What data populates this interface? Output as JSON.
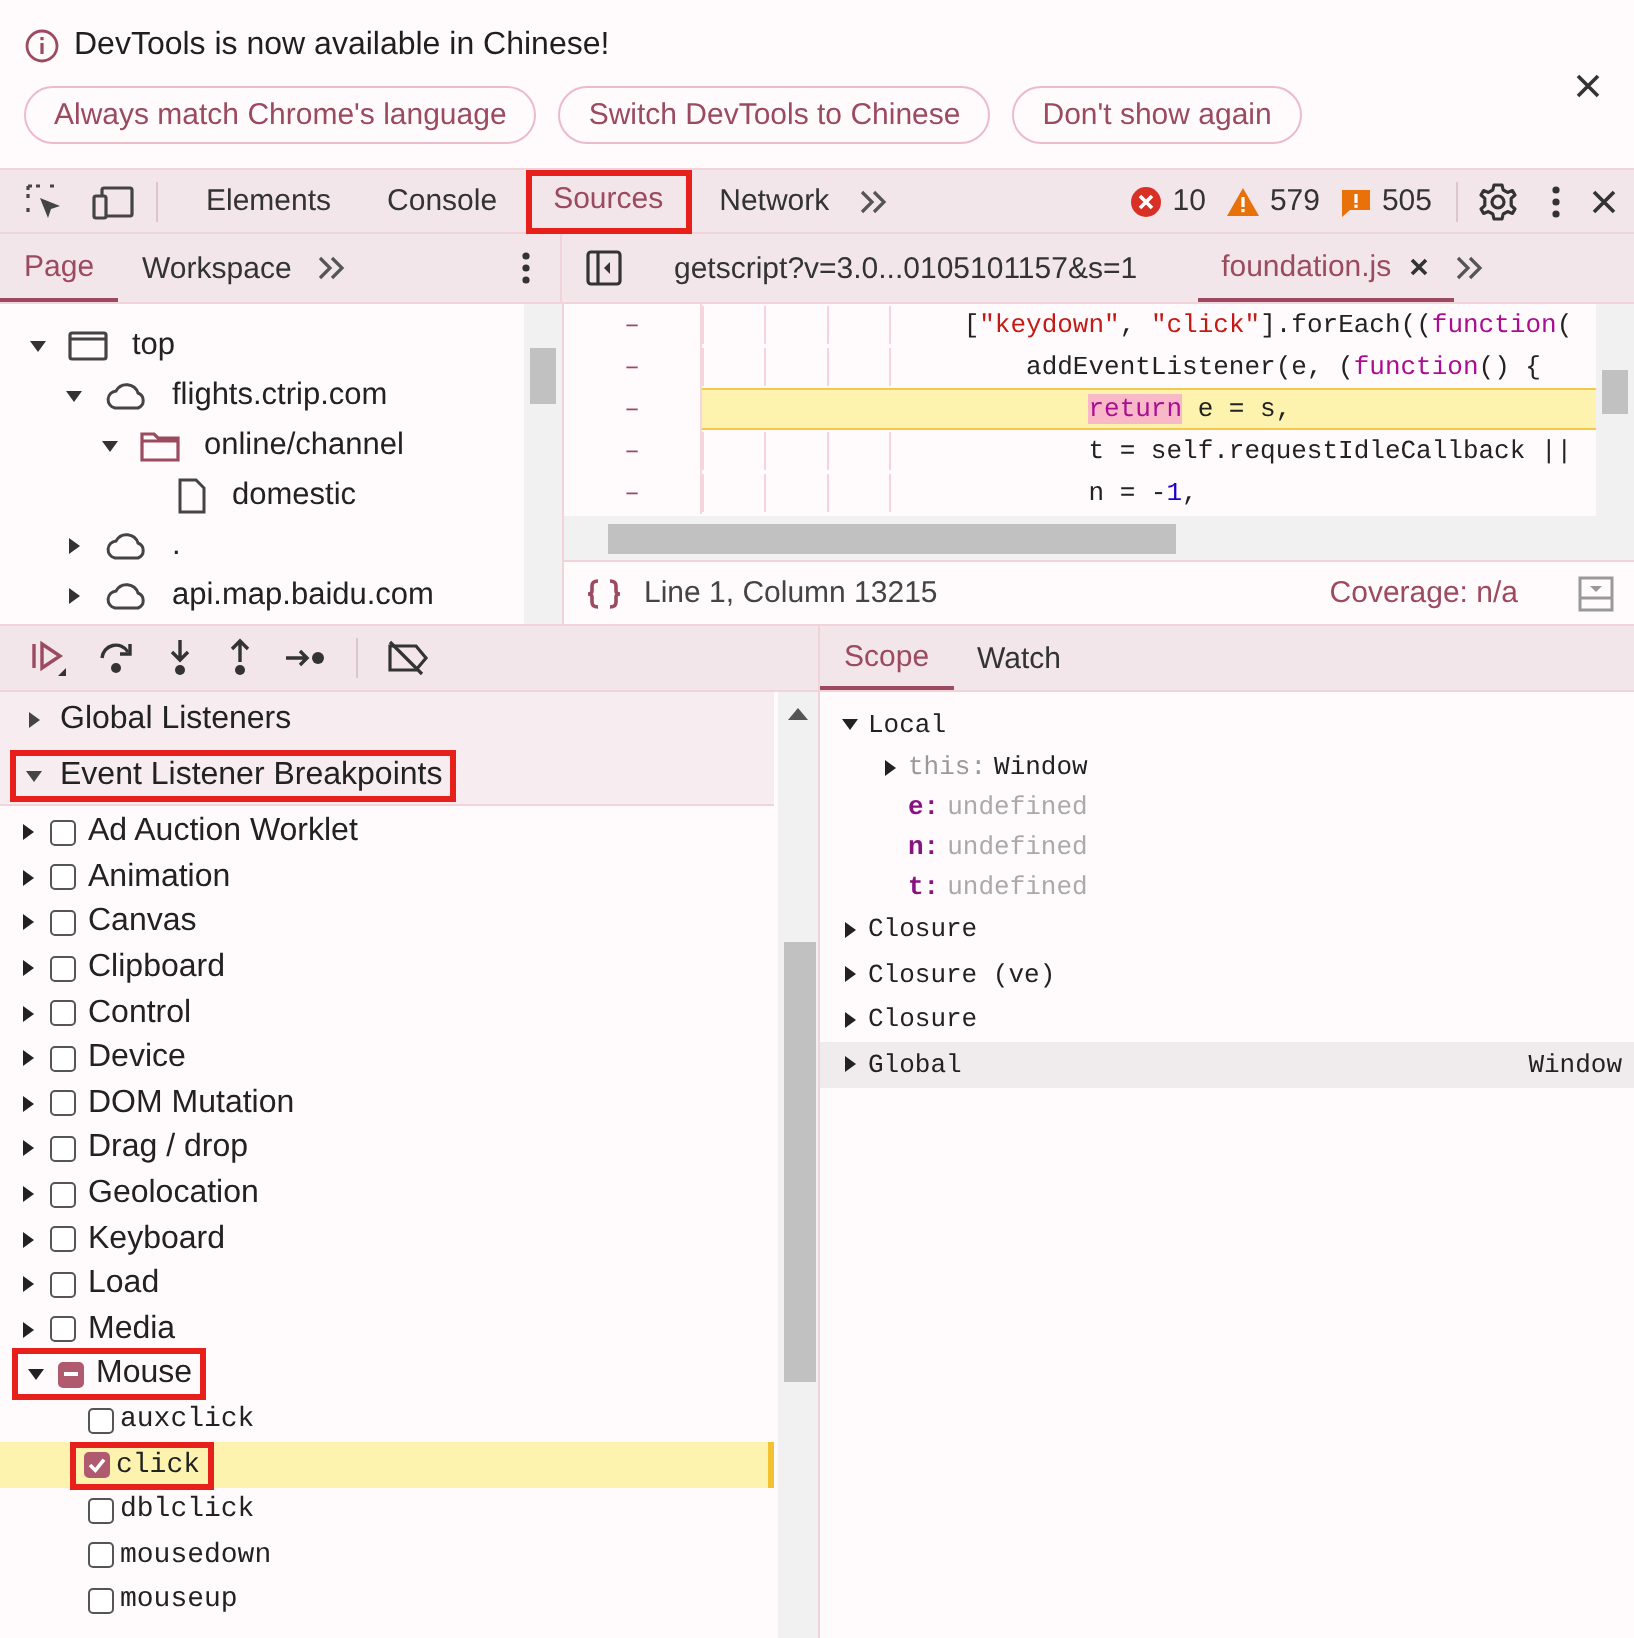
{
  "infobar": {
    "message": "DevTools is now available in Chinese!",
    "buttons": [
      "Always match Chrome's language",
      "Switch DevTools to Chinese",
      "Don't show again"
    ]
  },
  "main_tabs": [
    {
      "label": "Elements",
      "selected": false
    },
    {
      "label": "Console",
      "selected": false
    },
    {
      "label": "Sources",
      "selected": true,
      "annotated": true
    },
    {
      "label": "Network",
      "selected": false
    }
  ],
  "counters": [
    {
      "kind": "error",
      "count": "10"
    },
    {
      "kind": "warning",
      "count": "579"
    },
    {
      "kind": "issue",
      "count": "505"
    }
  ],
  "navigator": {
    "tabs": [
      {
        "label": "Page",
        "selected": true
      },
      {
        "label": "Workspace",
        "selected": false
      }
    ],
    "tree": [
      {
        "label": "top",
        "kind": "frame",
        "expanded": true,
        "children": [
          {
            "label": "flights.ctrip.com",
            "kind": "domain",
            "expanded": true,
            "children": [
              {
                "label": "online/channel",
                "kind": "folder",
                "expanded": true,
                "children": [
                  {
                    "label": "domestic",
                    "kind": "file"
                  }
                ]
              }
            ]
          },
          {
            "label": ".",
            "kind": "domain",
            "expanded": false
          },
          {
            "label": "api.map.baidu.com",
            "kind": "domain",
            "expanded": false
          }
        ]
      }
    ]
  },
  "editor": {
    "tabs": [
      {
        "label": "getscript?v=3.0...0105101157&s=1",
        "selected": false,
        "closable": false
      },
      {
        "label": "foundation.js",
        "selected": true,
        "closable": true
      }
    ],
    "lines": [
      {
        "marker": "–",
        "paused": false,
        "tokens": [
          {
            "kind": "plain",
            "text": "["
          },
          {
            "kind": "string",
            "text": "\"keydown\""
          },
          {
            "kind": "plain",
            "text": ", "
          },
          {
            "kind": "string",
            "text": "\"click\""
          },
          {
            "kind": "plain",
            "text": "].forEach(("
          },
          {
            "kind": "keyword",
            "text": "function"
          },
          {
            "kind": "plain",
            "text": "("
          }
        ],
        "children": [
          {
            "marker": "–",
            "paused": false,
            "tokens": [
              {
                "kind": "plain",
                "text": "addEventListener(e, ("
              },
              {
                "kind": "keyword",
                "text": "function"
              },
              {
                "kind": "plain",
                "text": "() {"
              }
            ],
            "children": [
              {
                "marker": "–",
                "paused": true,
                "tokens": [
                  {
                    "kind": "execution",
                    "text": "return"
                  },
                  {
                    "kind": "plain",
                    "text": " e = s,"
                  }
                ]
              },
              {
                "marker": "–",
                "paused": false,
                "tokens": [
                  {
                    "kind": "plain",
                    "text": "t = self.requestIdleCallback ||"
                  }
                ]
              },
              {
                "marker": "–",
                "paused": false,
                "tokens": [
                  {
                    "kind": "plain",
                    "text": "n = -"
                  },
                  {
                    "kind": "number",
                    "text": "1"
                  },
                  {
                    "kind": "plain",
                    "text": ","
                  }
                ]
              }
            ]
          }
        ]
      }
    ],
    "status": {
      "position": "Line 1, Column 13215",
      "coverage": "Coverage: n/a"
    }
  },
  "debugger": {
    "sections": [
      {
        "label": "Global Listeners",
        "expanded": false
      },
      {
        "label": "Event Listener Breakpoints",
        "expanded": true,
        "annotated": true,
        "categories": [
          {
            "label": "Ad Auction Worklet",
            "expanded": false,
            "checked": false,
            "indeterminate": false
          },
          {
            "label": "Animation",
            "expanded": false,
            "checked": false,
            "indeterminate": false
          },
          {
            "label": "Canvas",
            "expanded": false,
            "checked": false,
            "indeterminate": false
          },
          {
            "label": "Clipboard",
            "expanded": false,
            "checked": false,
            "indeterminate": false
          },
          {
            "label": "Control",
            "expanded": false,
            "checked": false,
            "indeterminate": false
          },
          {
            "label": "Device",
            "expanded": false,
            "checked": false,
            "indeterminate": false
          },
          {
            "label": "DOM Mutation",
            "expanded": false,
            "checked": false,
            "indeterminate": false
          },
          {
            "label": "Drag / drop",
            "expanded": false,
            "checked": false,
            "indeterminate": false
          },
          {
            "label": "Geolocation",
            "expanded": false,
            "checked": false,
            "indeterminate": false
          },
          {
            "label": "Keyboard",
            "expanded": false,
            "checked": false,
            "indeterminate": false
          },
          {
            "label": "Load",
            "expanded": false,
            "checked": false,
            "indeterminate": false
          },
          {
            "label": "Media",
            "expanded": false,
            "checked": false,
            "indeterminate": false
          },
          {
            "label": "Mouse",
            "expanded": true,
            "checked": false,
            "indeterminate": true,
            "annotated": true,
            "events": [
              {
                "label": "auxclick",
                "checked": false,
                "paused": false
              },
              {
                "label": "click",
                "checked": true,
                "paused": true,
                "annotated": true
              },
              {
                "label": "dblclick",
                "checked": false,
                "paused": false
              },
              {
                "label": "mousedown",
                "checked": false,
                "paused": false
              },
              {
                "label": "mouseup",
                "checked": false,
                "paused": false
              }
            ]
          }
        ]
      }
    ],
    "scope_tabs": [
      {
        "label": "Scope",
        "selected": true
      },
      {
        "label": "Watch",
        "selected": false
      }
    ],
    "scope": [
      {
        "name": "Local",
        "expanded": true,
        "children": [
          {
            "name": "this:",
            "kind": "receiver",
            "value": "Window",
            "dimmed": false,
            "expanded": false
          },
          {
            "name": "e:",
            "kind": "variable",
            "value": "undefined",
            "dimmed": true
          },
          {
            "name": "n:",
            "kind": "variable",
            "value": "undefined",
            "dimmed": true
          },
          {
            "name": "t:",
            "kind": "variable",
            "value": "undefined",
            "dimmed": true
          }
        ]
      },
      {
        "name": "Closure",
        "expanded": false
      },
      {
        "name": "Closure (ve)",
        "expanded": false
      },
      {
        "name": "Closure",
        "expanded": false
      },
      {
        "name": "Global",
        "expanded": false,
        "value": "Window",
        "dimmed": false,
        "hovered": true
      }
    ]
  }
}
